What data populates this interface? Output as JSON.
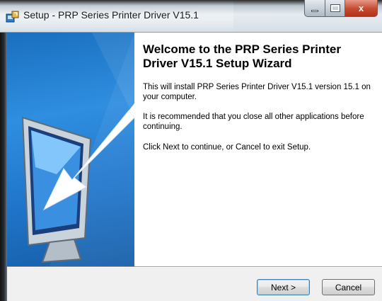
{
  "window": {
    "title": "Setup - PRP Series Printer Driver V15.1",
    "close_glyph": "x"
  },
  "welcome": {
    "heading": "Welcome to the PRP Series Printer Driver V15.1 Setup Wizard",
    "paragraph1": "This will install PRP Series Printer Driver V15.1 version 15.1 on your computer.",
    "paragraph2": "It is recommended that you close all other applications before continuing.",
    "paragraph3": "Click Next to continue, or Cancel to exit Setup."
  },
  "buttons": {
    "next": "Next >",
    "cancel": "Cancel"
  },
  "icons": {
    "app": "setup-installer-icon",
    "banner": "computer-monitor-arrow-illustration"
  },
  "colors": {
    "banner_blue": "#2f8ee0",
    "close_red": "#c44a30",
    "dialog_bg": "#f0f0f0"
  }
}
